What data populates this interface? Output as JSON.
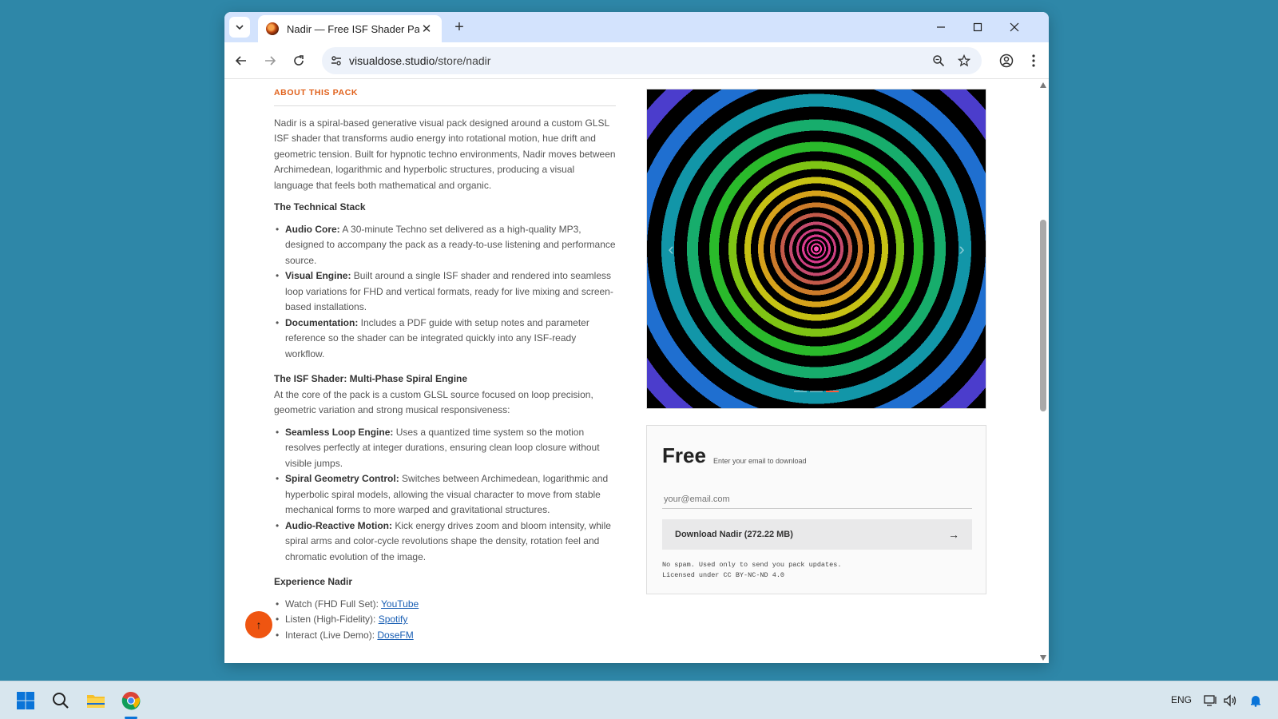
{
  "browser": {
    "tab_title": "Nadir — Free ISF Shader Pack |",
    "url_domain": "visualdose.studio",
    "url_path": "/store/nadir"
  },
  "page": {
    "section_label": "ABOUT THIS PACK",
    "intro": "Nadir is a spiral-based generative visual pack designed around a custom GLSL ISF shader that transforms audio energy into rotational motion, hue drift and geometric tension. Built for hypnotic techno environments, Nadir moves between Archimedean, logarithmic and hyperbolic structures, producing a visual language that feels both mathematical and organic.",
    "stack_heading": "The Technical Stack",
    "stack_items": [
      {
        "label": "Audio Core:",
        "text": " A 30-minute Techno set delivered as a high-quality MP3, designed to accompany the pack as a ready-to-use listening and performance source."
      },
      {
        "label": "Visual Engine:",
        "text": " Built around a single ISF shader and rendered into seamless loop variations for FHD and vertical formats, ready for live mixing and screen-based installations."
      },
      {
        "label": "Documentation:",
        "text": " Includes a PDF guide with setup notes and parameter reference so the shader can be integrated quickly into any ISF-ready workflow."
      }
    ],
    "shader_heading": "The ISF Shader: Multi-Phase Spiral Engine",
    "shader_intro": "At the core of the pack is a custom GLSL source focused on loop precision, geometric variation and strong musical responsiveness:",
    "shader_items": [
      {
        "label": "Seamless Loop Engine:",
        "text": " Uses a quantized time system so the motion resolves perfectly at integer durations, ensuring clean loop closure without visible jumps."
      },
      {
        "label": "Spiral Geometry Control:",
        "text": " Switches between Archimedean, logarithmic and hyperbolic spiral models, allowing the visual character to move from stable mechanical forms to more warped and gravitational structures."
      },
      {
        "label": "Audio-Reactive Motion:",
        "text": " Kick energy drives zoom and bloom intensity, while spiral arms and color-cycle revolutions shape the density, rotation feel and chromatic evolution of the image."
      }
    ],
    "experience_heading": "Experience Nadir",
    "experience_items": [
      {
        "label": "Watch (FHD Full Set): ",
        "link": "YouTube"
      },
      {
        "label": "Listen (High-Fidelity): ",
        "link": "Spotify"
      },
      {
        "label": "Interact (Live Demo): ",
        "link": "DoseFM"
      }
    ]
  },
  "carousel": {
    "slide_count": 3,
    "active_slide": 3
  },
  "download_card": {
    "price": "Free",
    "price_note": "Enter your email to download",
    "email_placeholder": "your@email.com",
    "download_label": "Download Nadir (272.22 MB)",
    "download_arrow": "→",
    "fine_print_1": "No spam. Used only to send you pack updates.",
    "fine_print_2": "Licensed under CC BY-NC-ND 4.0"
  },
  "taskbar": {
    "language": "ENG"
  },
  "colors": {
    "accent": "#e0601a",
    "fab": "#ef5511",
    "link": "#1a5fb4",
    "desktop": "#2e87a8"
  }
}
